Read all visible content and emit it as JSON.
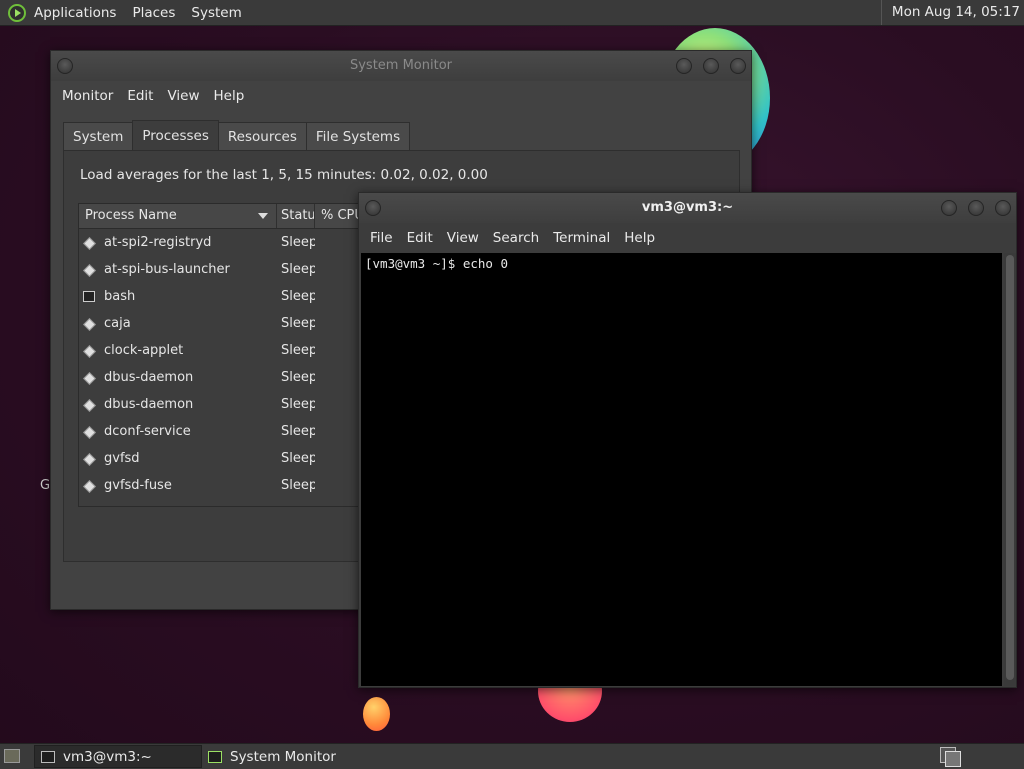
{
  "top_panel": {
    "menus": [
      "Applications",
      "Places",
      "System"
    ],
    "clock": "Mon Aug 14, 05:17"
  },
  "desktop": {
    "partial_text": "G"
  },
  "system_monitor": {
    "title": "System Monitor",
    "menus": [
      "Monitor",
      "Edit",
      "View",
      "Help"
    ],
    "tabs": [
      "System",
      "Processes",
      "Resources",
      "File Systems"
    ],
    "active_tab": "Processes",
    "load_text": "Load averages for the last 1, 5, 15 minutes: 0.02, 0.02, 0.00",
    "columns": [
      "Process Name",
      "Statu",
      "% CPU"
    ],
    "processes": [
      {
        "name": "at-spi2-registryd",
        "status": "Sleep",
        "icon": "process-icon"
      },
      {
        "name": "at-spi-bus-launcher",
        "status": "Sleep",
        "icon": "process-icon"
      },
      {
        "name": "bash",
        "status": "Sleep",
        "icon": "terminal-icon"
      },
      {
        "name": "caja",
        "status": "Sleep",
        "icon": "process-icon"
      },
      {
        "name": "clock-applet",
        "status": "Sleep",
        "icon": "process-icon"
      },
      {
        "name": "dbus-daemon",
        "status": "Sleep",
        "icon": "process-icon"
      },
      {
        "name": "dbus-daemon",
        "status": "Sleep",
        "icon": "process-icon"
      },
      {
        "name": "dconf-service",
        "status": "Sleep",
        "icon": "process-icon"
      },
      {
        "name": "gvfsd",
        "status": "Sleep",
        "icon": "process-icon"
      },
      {
        "name": "gvfsd-fuse",
        "status": "Sleep",
        "icon": "process-icon"
      }
    ]
  },
  "terminal": {
    "title": "vm3@vm3:~",
    "menus": [
      "File",
      "Edit",
      "View",
      "Search",
      "Terminal",
      "Help"
    ],
    "content": "[vm3@vm3 ~]$ echo 0"
  },
  "taskbar": {
    "tasks": [
      {
        "label": "vm3@vm3:~",
        "active": true
      },
      {
        "label": "System Monitor",
        "active": false
      }
    ]
  }
}
